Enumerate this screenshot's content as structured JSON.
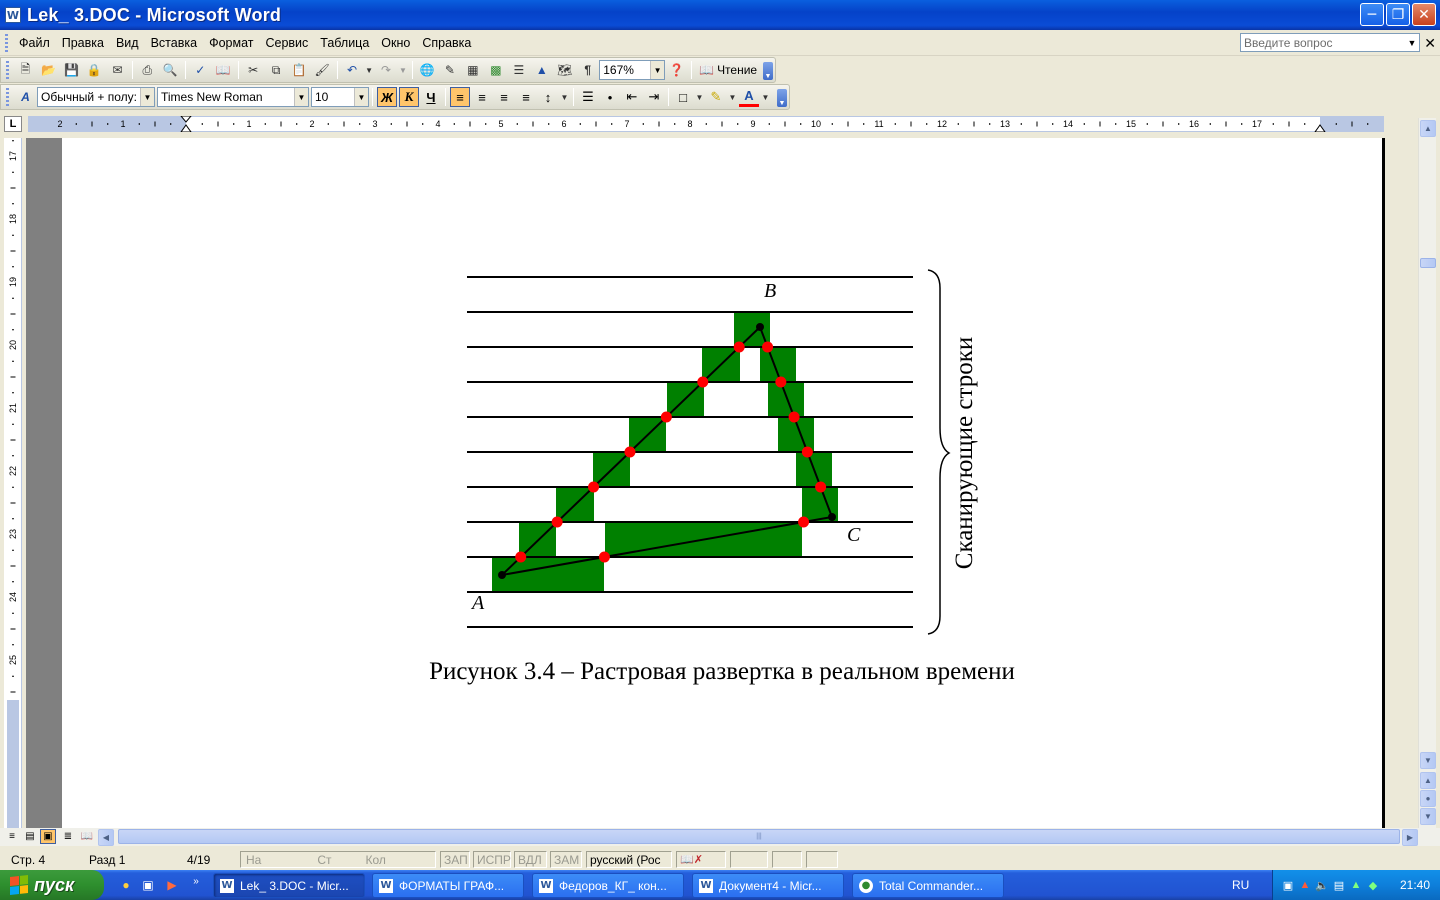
{
  "window": {
    "title": "Lek_ 3.DOC - Microsoft Word"
  },
  "menu": {
    "items": [
      "Файл",
      "Правка",
      "Вид",
      "Вставка",
      "Формат",
      "Сервис",
      "Таблица",
      "Окно",
      "Справка"
    ],
    "ask_placeholder": "Введите вопрос"
  },
  "toolbar": {
    "zoom": "167%",
    "reading_label": "Чтение",
    "style": "Обычный + полу:",
    "font": "Times New Roman",
    "size": "10",
    "bold": "Ж",
    "italic": "К",
    "underline": "Ч"
  },
  "ruler": {
    "h_numbers": [
      "2",
      "1",
      "1",
      "2",
      "3",
      "4",
      "5",
      "6",
      "7",
      "8",
      "9",
      "10",
      "11",
      "12",
      "13",
      "14",
      "15",
      "16",
      "17"
    ],
    "v_numbers": [
      "17",
      "18",
      "19",
      "20",
      "21",
      "22",
      "23",
      "24",
      "25",
      "26",
      "27"
    ]
  },
  "figure": {
    "label_b": "B",
    "label_a": "A",
    "label_c": "C",
    "brace_label": "Сканирующие строки",
    "caption": "Рисунок 3.4 – Растровая развертка в реальном времени",
    "colors": {
      "fill": "#008000",
      "dot": "#ff0000",
      "line": "#000000"
    }
  },
  "status": {
    "page": "Стр. 4",
    "section": "Разд 1",
    "pages": "4/19",
    "at": "На",
    "line": "Ст",
    "col": "Кол",
    "rec": "ЗАП",
    "trk": "ИСПР",
    "ext": "ВДЛ",
    "ovr": "ЗАМ",
    "language": "русский (Рос"
  },
  "taskbar": {
    "start": "пуск",
    "tasks": [
      "Lek_ 3.DOC - Micr...",
      "ФОРМАТЫ ГРАФ...",
      "Федоров_КГ_ кон...",
      "Документ4 - Micr...",
      "Total Commander..."
    ],
    "lang": "RU",
    "clock": "21:40"
  }
}
